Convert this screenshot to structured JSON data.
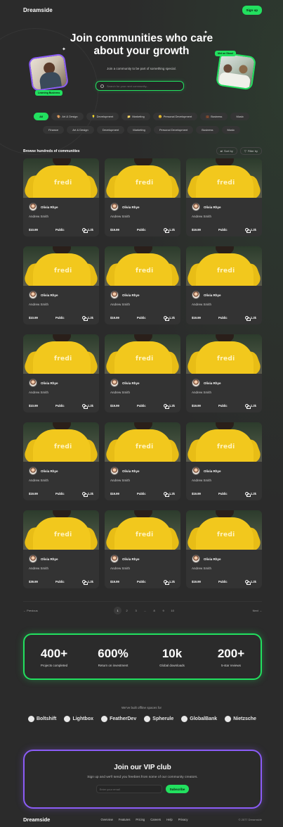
{
  "header": {
    "logo": "Dreamside",
    "signup_label": "Sign up"
  },
  "hero": {
    "title": "Join communities who care about your growth",
    "subtitle": "Join a community to be part of something special.",
    "search_placeholder": "Search for your next community...",
    "tag_left": "Learning Business",
    "tag_right": "Met on Skool"
  },
  "categories_row1": [
    {
      "label": "All",
      "emoji": ""
    },
    {
      "label": "Art & Design",
      "emoji": "🎨"
    },
    {
      "label": "Development",
      "emoji": "💡"
    },
    {
      "label": "Marketing",
      "emoji": "📁"
    },
    {
      "label": "Personal Development",
      "emoji": "😊"
    },
    {
      "label": "Business",
      "emoji": "💼"
    },
    {
      "label": "Music",
      "emoji": ""
    }
  ],
  "categories_row2": [
    "Finance",
    "Art & Design",
    "Development",
    "Marketing",
    "Personal Development",
    "Business",
    "Music"
  ],
  "browse": {
    "title": "Browse hundreds of communities",
    "sort_label": "Sort by",
    "filter_label": "Filter by"
  },
  "card_image_text": "fredi",
  "cards": [
    {
      "author": "Olivia Rhye",
      "title": "Andrew Smith",
      "price": "$10.99",
      "visibility": "Public",
      "members": "1.2k"
    },
    {
      "author": "Olivia Rhye",
      "title": "Andrew Smith",
      "price": "$19.99",
      "visibility": "Public",
      "members": "1.2k"
    },
    {
      "author": "Olivia Rhye",
      "title": "Andrew Smith",
      "price": "$19.99",
      "visibility": "Public",
      "members": "1.2k"
    },
    {
      "author": "Olivia Rhye",
      "title": "Andrew Smith",
      "price": "$10.99",
      "visibility": "Public",
      "members": "1.2k"
    },
    {
      "author": "Olivia Rhye",
      "title": "Andrew Smith",
      "price": "$19.99",
      "visibility": "Public",
      "members": "1.2k"
    },
    {
      "author": "Olivia Rhye",
      "title": "Andrew Smith",
      "price": "$19.99",
      "visibility": "Public",
      "members": "1.2k"
    },
    {
      "author": "Olivia Rhye",
      "title": "Andrew Smith",
      "price": "$10.99",
      "visibility": "Public",
      "members": "1.2k"
    },
    {
      "author": "Olivia Rhye",
      "title": "Andrew Smith",
      "price": "$19.99",
      "visibility": "Public",
      "members": "1.2k"
    },
    {
      "author": "Olivia Rhye",
      "title": "Andrew Smith",
      "price": "$19.99",
      "visibility": "Public",
      "members": "1.2k"
    },
    {
      "author": "Olivia Rhye",
      "title": "Andrew Smith",
      "price": "$19.99",
      "visibility": "Public",
      "members": "1.2k"
    },
    {
      "author": "Olivia Rhye",
      "title": "Andrew Smith",
      "price": "$19.99",
      "visibility": "Public",
      "members": "1.2k"
    },
    {
      "author": "Olivia Rhye",
      "title": "Andrew Smith",
      "price": "$19.99",
      "visibility": "Public",
      "members": "1.2k"
    },
    {
      "author": "Olivia Rhye",
      "title": "Andrew Smith",
      "price": "$39.99",
      "visibility": "Public",
      "members": "1.2k"
    },
    {
      "author": "Olivia Rhye",
      "title": "Andrew Smith",
      "price": "$19.99",
      "visibility": "Public",
      "members": "1.2k"
    },
    {
      "author": "Olivia Rhye",
      "title": "Andrew Smith",
      "price": "$19.99",
      "visibility": "Public",
      "members": "1.2k"
    }
  ],
  "pagination": {
    "previous": "Previous",
    "next": "Next",
    "pages": [
      "1",
      "2",
      "3",
      "...",
      "8",
      "9",
      "10"
    ],
    "active_page": "1"
  },
  "stats": [
    {
      "value": "400+",
      "label": "Projects completed"
    },
    {
      "value": "600%",
      "label": "Return on investment"
    },
    {
      "value": "10k",
      "label": "Global downloads"
    },
    {
      "value": "200+",
      "label": "5-star reviews"
    }
  ],
  "brands_caption": "We've built offline spaces for",
  "brands": [
    "Boltshift",
    "Lightbox",
    "FeatherDev",
    "Spherule",
    "GlobalBank",
    "Nietzsche"
  ],
  "vip": {
    "title": "Join our VIP club",
    "subtitle": "Sign up and we'll send you freebies from some of our community creators.",
    "email_placeholder": "Enter your email",
    "subscribe_label": "Subscribe"
  },
  "footer": {
    "logo": "Dreamside",
    "links": [
      "Overview",
      "Features",
      "Pricing",
      "Careers",
      "Help",
      "Privacy"
    ],
    "copyright": "© 2077 Dreamside"
  },
  "colors": {
    "accent_green": "#22e05f",
    "accent_purple": "#8b5cf6",
    "background": "#2b2b2b",
    "card": "#333333"
  }
}
